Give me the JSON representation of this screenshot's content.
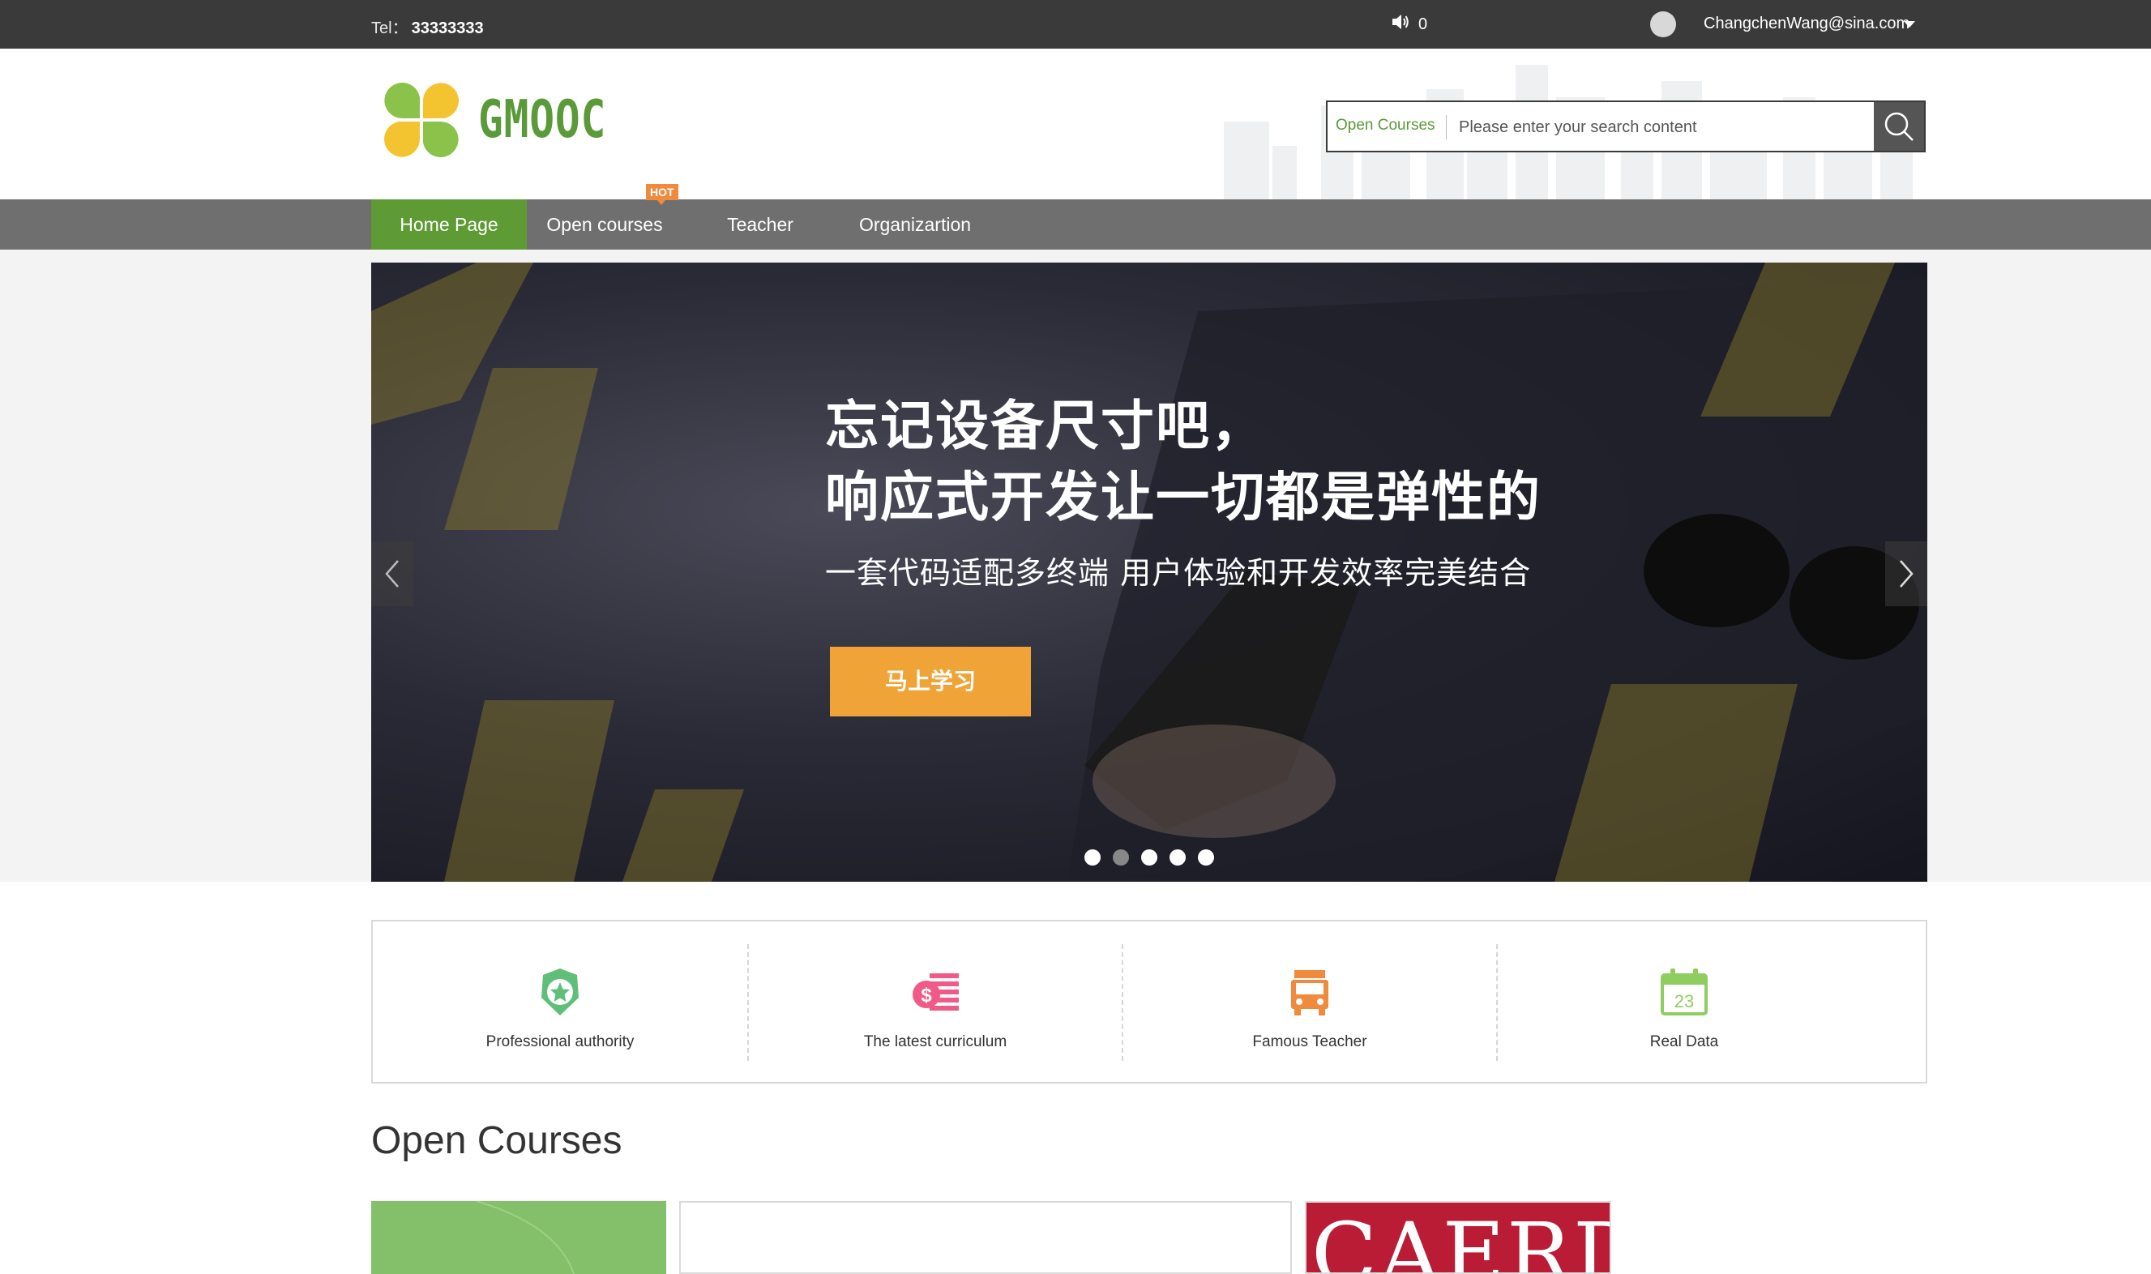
{
  "topbar": {
    "tel_label": "Tel：",
    "tel_number": "33333333",
    "message_count": "0",
    "user_email": "ChangchenWang@sina.com"
  },
  "header": {
    "logo_text": "GMOOC",
    "search": {
      "type_label": "Open Courses",
      "placeholder": "Please enter your search content"
    }
  },
  "nav": {
    "items": [
      {
        "label": "Home Page",
        "active": true
      },
      {
        "label": "Open courses",
        "active": false
      },
      {
        "label": "Teacher",
        "active": false
      },
      {
        "label": "Organizartion",
        "active": false
      }
    ],
    "hot_badge": "HOT"
  },
  "banner": {
    "title_line1": "忘记设备尺寸吧，",
    "title_line2": "响应式开发让一切都是弹性的",
    "subtitle": "一套代码适配多终端 用户体验和开发效率完美结合",
    "button_label": "马上学习",
    "slide_count": 5,
    "active_slide": 2
  },
  "features": [
    {
      "label": "Professional authority",
      "icon": "badge-star-icon",
      "color": "#5fbf7a"
    },
    {
      "label": "The latest curriculum",
      "icon": "dollar-list-icon",
      "color": "#ef5b86"
    },
    {
      "label": "Famous Teacher",
      "icon": "bus-icon",
      "color": "#f08a3c"
    },
    {
      "label": "Real Data",
      "icon": "calendar-23-icon",
      "color": "#8fce5e"
    }
  ],
  "calendar_day": "23",
  "open_courses": {
    "title": "Open Courses",
    "card3_text": "CAERDYDD"
  },
  "colors": {
    "topbar": "#3a3a3a",
    "nav": "#6f6f6f",
    "nav_active": "#5e9b35",
    "accent_green": "#5a9a38",
    "banner_button": "#f0a336"
  }
}
